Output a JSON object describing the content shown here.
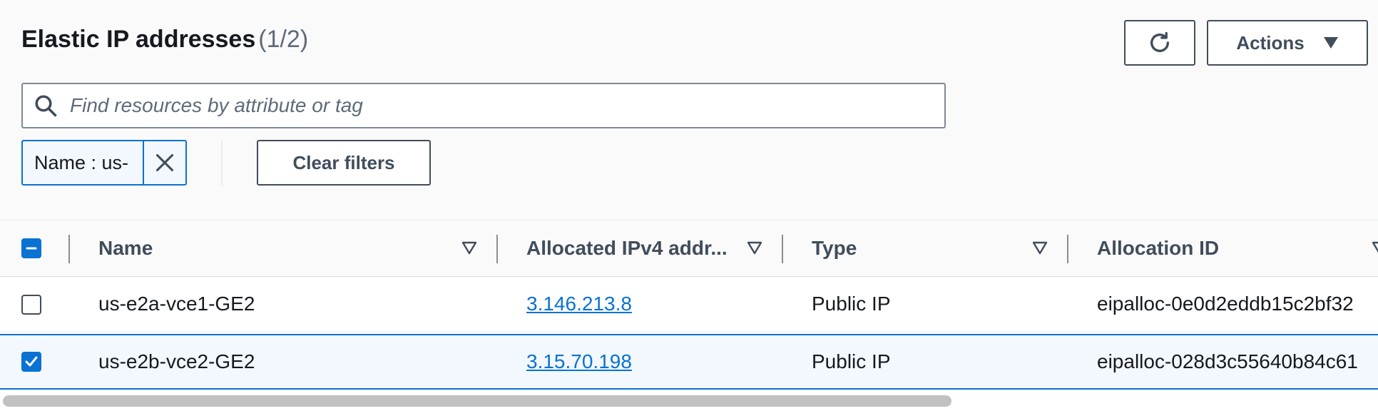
{
  "header": {
    "title": "Elastic IP addresses",
    "count": "(1/2)",
    "actions_label": "Actions"
  },
  "search": {
    "placeholder": "Find resources by attribute or tag",
    "value": ""
  },
  "filter_token": {
    "label": "Name : us-"
  },
  "clear_filters_label": "Clear filters",
  "table": {
    "columns": [
      "Name",
      "Allocated IPv4 addr...",
      "Type",
      "Allocation ID"
    ],
    "rows": [
      {
        "name": "us-e2a-vce1-GE2",
        "ip": "3.146.213.8",
        "type": "Public IP",
        "allocation_id": "eipalloc-0e0d2eddb15c2bf32",
        "selected": false
      },
      {
        "name": "us-e2b-vce2-GE2",
        "ip": "3.15.70.198",
        "type": "Public IP",
        "allocation_id": "eipalloc-028d3c55640b84c61",
        "selected": true
      }
    ]
  },
  "colors": {
    "accent": "#0972d3",
    "selected_row_bg": "#f2f8fd",
    "text": "#16191f",
    "muted": "#5f6b7a"
  },
  "icons": [
    "refresh-icon",
    "caret-down-icon",
    "search-icon",
    "close-icon",
    "sort-icon",
    "checkbox-indeterminate-icon",
    "checkmark-icon"
  ]
}
